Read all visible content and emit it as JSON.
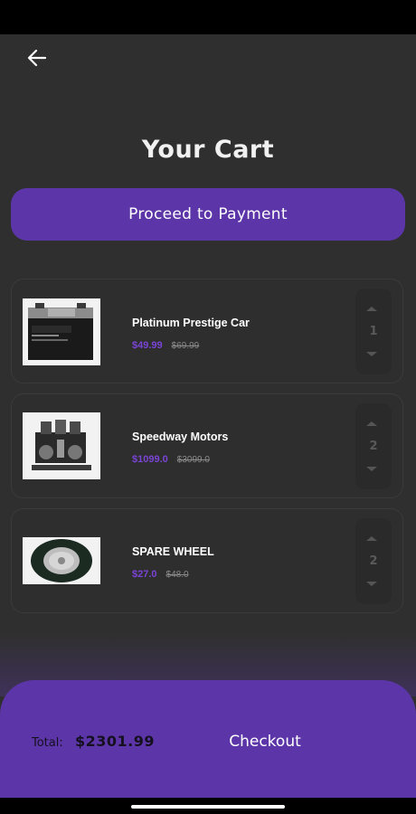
{
  "header": {
    "title": "Your Cart",
    "back_icon": "arrow-left-icon"
  },
  "actions": {
    "proceed_label": "Proceed to Payment"
  },
  "cart": {
    "items": [
      {
        "name": "Platinum Prestige Car",
        "price": "$49.99",
        "old_price": "$69.99",
        "quantity": "1",
        "image": "car-battery-image"
      },
      {
        "name": "Speedway Motors",
        "price": "$1099.0",
        "old_price": "$3099.0",
        "quantity": "2",
        "image": "engine-image"
      },
      {
        "name": "SPARE WHEEL",
        "price": "$27.0",
        "old_price": "$48.0",
        "quantity": "2",
        "image": "wheel-image"
      }
    ]
  },
  "footer": {
    "total_label": "Total:",
    "total_value": "$2301.99",
    "checkout_label": "Checkout"
  },
  "colors": {
    "accent": "#5c36a8",
    "price": "#7a44d6",
    "background": "#2f2f2f"
  }
}
